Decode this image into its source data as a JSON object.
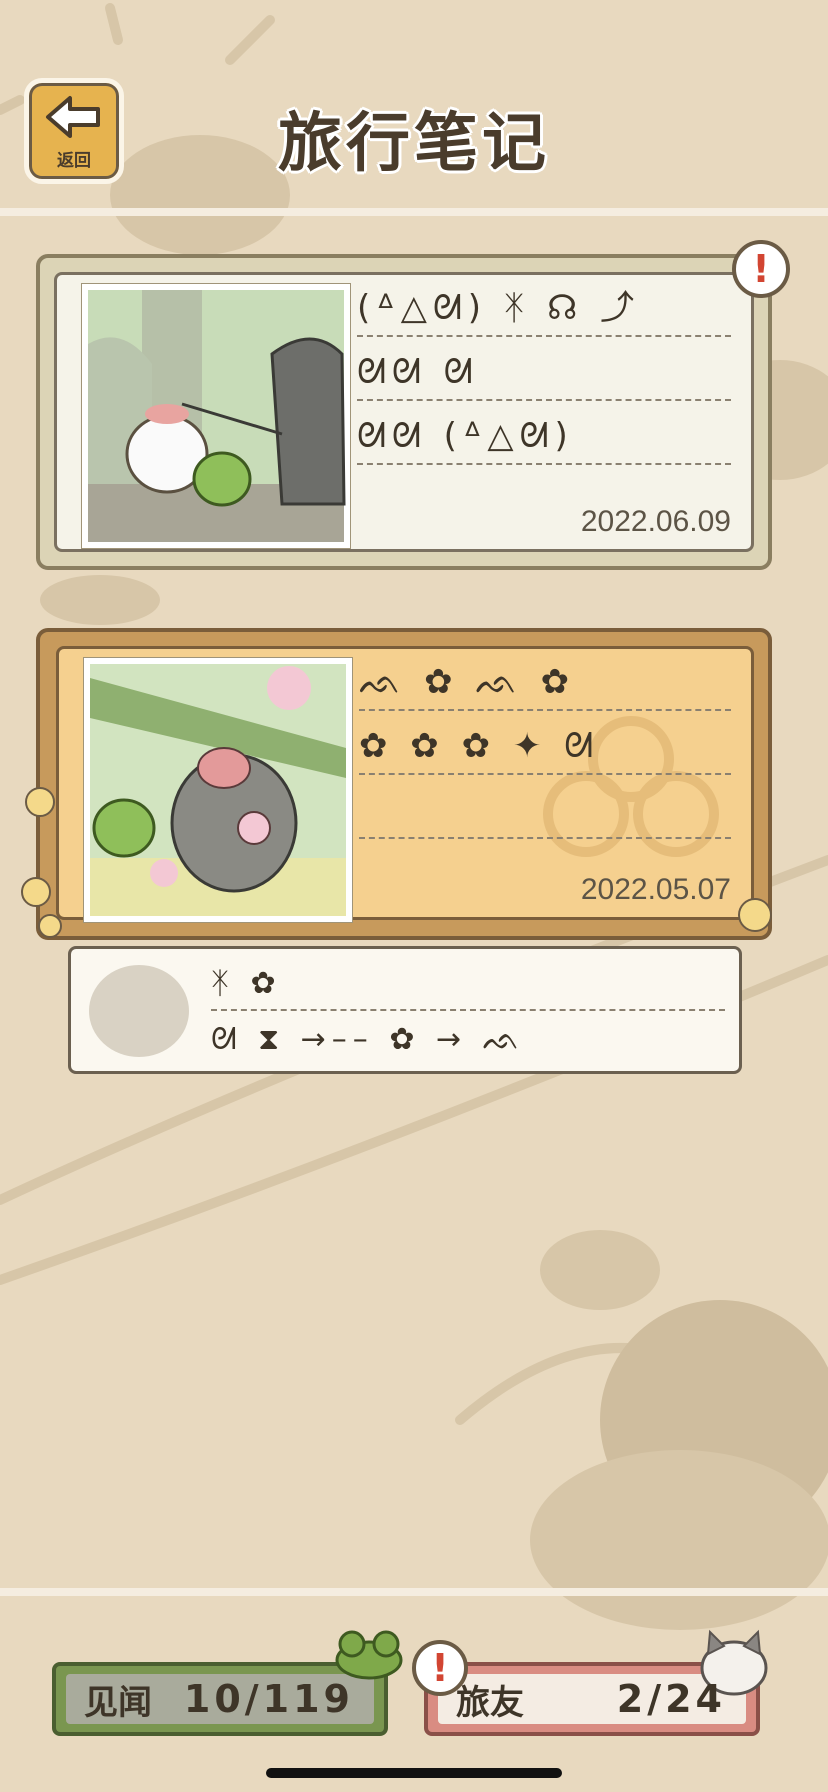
{
  "header": {
    "back_label": "返回",
    "title": "旅行笔记"
  },
  "entries": [
    {
      "glyph_lines": [
        "(ᐞ△ᘛ) ᛡ ☊ ⤴",
        "ᘛᘛ ᘛ",
        "ᘛᘛ (ᐞ△ᘛ)"
      ],
      "date": "2022.06.09",
      "alert": "!"
    },
    {
      "glyph_lines": [
        "ᨒ ✿ ᨒ ✿",
        "✿ ✿ ✿ ✦ ᘛ",
        ""
      ],
      "date": "2022.05.07",
      "reply_lines": [
        "ᛡ ✿",
        "ᘛ ⧗ →–– ✿ → ᨒ"
      ]
    }
  ],
  "tabs": {
    "sightings_label": "见闻",
    "sightings_count": "10/119",
    "friends_label": "旅友",
    "friends_count": "2/24",
    "friends_alert": "!"
  },
  "colors": {
    "background": "#e8d9bf",
    "alert_red": "#d24532",
    "unread_card": "#f5d08f"
  }
}
